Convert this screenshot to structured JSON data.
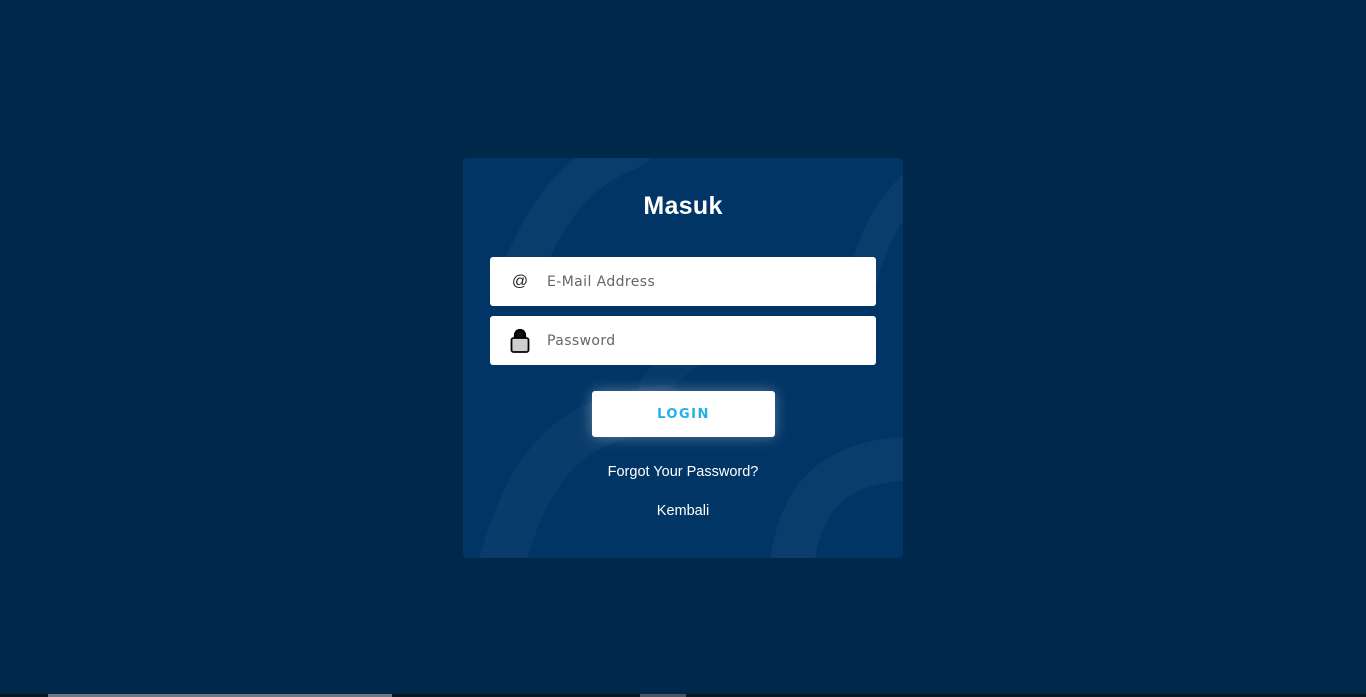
{
  "login_card": {
    "title": "Masuk",
    "email": {
      "placeholder": "E-Mail Address",
      "value": "",
      "icon": "at-sign-icon",
      "icon_glyph": "@"
    },
    "password": {
      "placeholder": "Password",
      "value": "",
      "icon": "padlock-icon"
    },
    "login_label": "LOGIN",
    "forgot_label": "Forgot Your Password?",
    "back_label": "Kembali"
  },
  "colors": {
    "page_background": "#00284b",
    "card_background": "#003566",
    "button_text": "#1fb0e8",
    "link_text": "#ffffff"
  }
}
